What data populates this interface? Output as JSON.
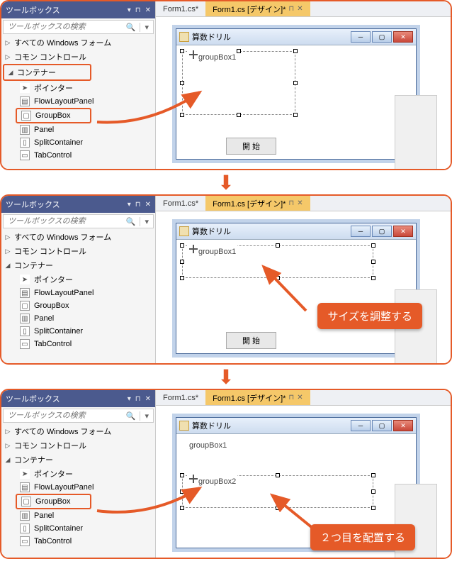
{
  "toolbox": {
    "title": "ツールボックス",
    "search_placeholder": "ツールボックスの検索",
    "categories": [
      {
        "label": "すべての Windows フォーム",
        "expanded": false
      },
      {
        "label": "コモン コントロール",
        "expanded": false
      },
      {
        "label": "コンテナー",
        "expanded": true
      }
    ],
    "container_items": [
      {
        "label": "ポインター",
        "icon": "pointer"
      },
      {
        "label": "FlowLayoutPanel",
        "icon": "flow"
      },
      {
        "label": "GroupBox",
        "icon": "group"
      },
      {
        "label": "Panel",
        "icon": "panel"
      },
      {
        "label": "SplitContainer",
        "icon": "split"
      },
      {
        "label": "TabControl",
        "icon": "tab"
      }
    ]
  },
  "tabs": {
    "code": "Form1.cs*",
    "design": "Form1.cs [デザイン]*"
  },
  "form": {
    "title": "算数ドリル",
    "groupbox1": "groupBox1",
    "groupbox2": "groupBox2",
    "start_button": "開 始"
  },
  "callouts": {
    "resize": "サイズを調整する",
    "second": "２つ目を配置する"
  }
}
